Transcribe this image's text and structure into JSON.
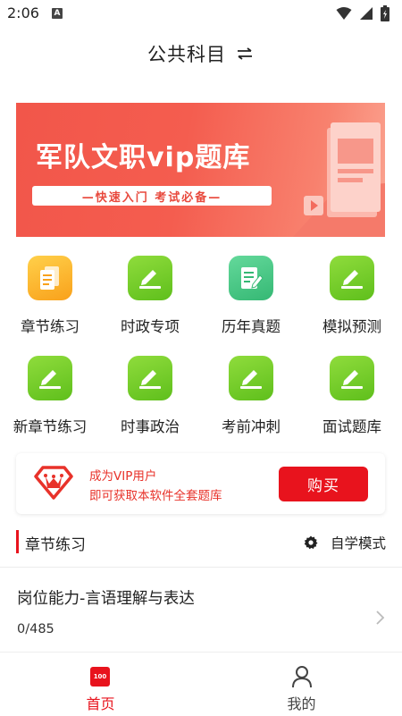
{
  "status_bar": {
    "time": "2:06",
    "badge": "A",
    "icons": [
      "settings-dot-icon",
      "wifi-icon",
      "signal-icon",
      "battery-charging-icon"
    ]
  },
  "header": {
    "title": "公共科目",
    "switch_icon": "swap-icon"
  },
  "banner": {
    "title": "军队文职vip题库",
    "subtitle": "—快速入门 考试必备—",
    "colors": {
      "start": "#f2564a",
      "end": "#fba491"
    }
  },
  "grid": {
    "items": [
      {
        "label": "章节练习",
        "icon": "document-stack-icon",
        "color": "orange"
      },
      {
        "label": "时政专项",
        "icon": "pencil-edit-icon",
        "color": "green"
      },
      {
        "label": "历年真题",
        "icon": "paper-pencil-icon",
        "color": "teal"
      },
      {
        "label": "模拟预测",
        "icon": "pencil-edit-icon",
        "color": "green"
      },
      {
        "label": "新章节练习",
        "icon": "pencil-edit-icon",
        "color": "green"
      },
      {
        "label": "时事政治",
        "icon": "pencil-edit-icon",
        "color": "green"
      },
      {
        "label": "考前冲刺",
        "icon": "pencil-edit-icon",
        "color": "green"
      },
      {
        "label": "面试题库",
        "icon": "pencil-edit-icon",
        "color": "green"
      }
    ]
  },
  "vip": {
    "line1": "成为VIP用户",
    "line2": "即可获取本软件全套题库",
    "buy_label": "购买",
    "icon": "vip-crown-diamond-icon",
    "accent": "#e8131d"
  },
  "section": {
    "title": "章节练习",
    "mode_label": "自学模式",
    "mode_icon": "gear-icon"
  },
  "list": {
    "items": [
      {
        "title": "岗位能力-言语理解与表达",
        "progress": "0/485"
      }
    ]
  },
  "tabbar": {
    "tabs": [
      {
        "label": "首页",
        "icon": "home-100-icon",
        "icon_text": "100",
        "active": true
      },
      {
        "label": "我的",
        "icon": "person-icon",
        "active": false
      }
    ]
  }
}
